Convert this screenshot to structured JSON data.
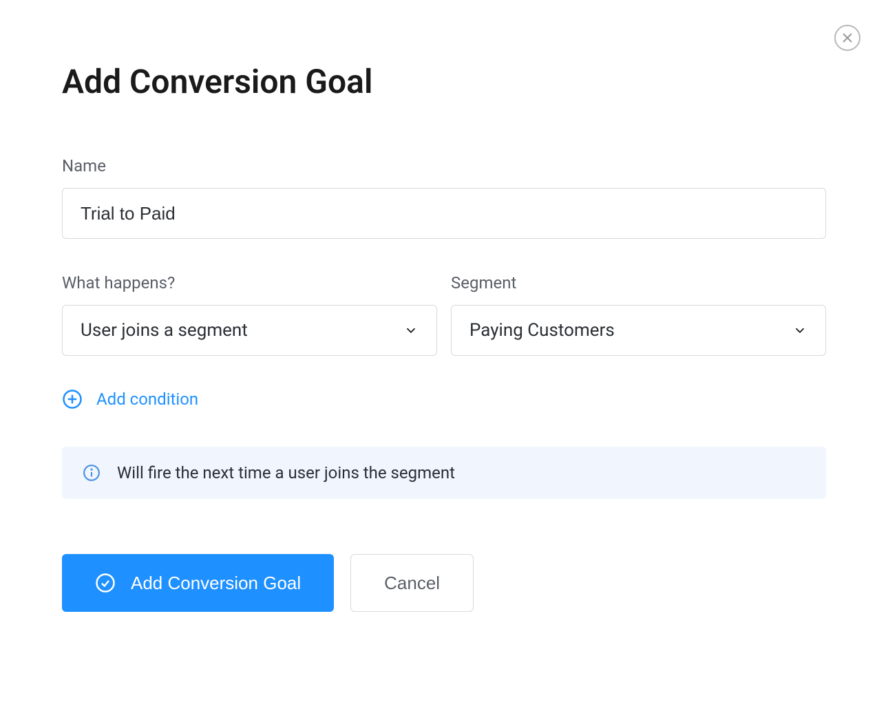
{
  "modal": {
    "title": "Add Conversion Goal",
    "name_label": "Name",
    "name_value": "Trial to Paid",
    "what_happens_label": "What happens?",
    "what_happens_value": "User joins a segment",
    "segment_label": "Segment",
    "segment_value": "Paying Customers",
    "add_condition_label": "Add condition",
    "info_text": "Will fire the next time a user joins the segment",
    "submit_label": "Add Conversion Goal",
    "cancel_label": "Cancel"
  }
}
